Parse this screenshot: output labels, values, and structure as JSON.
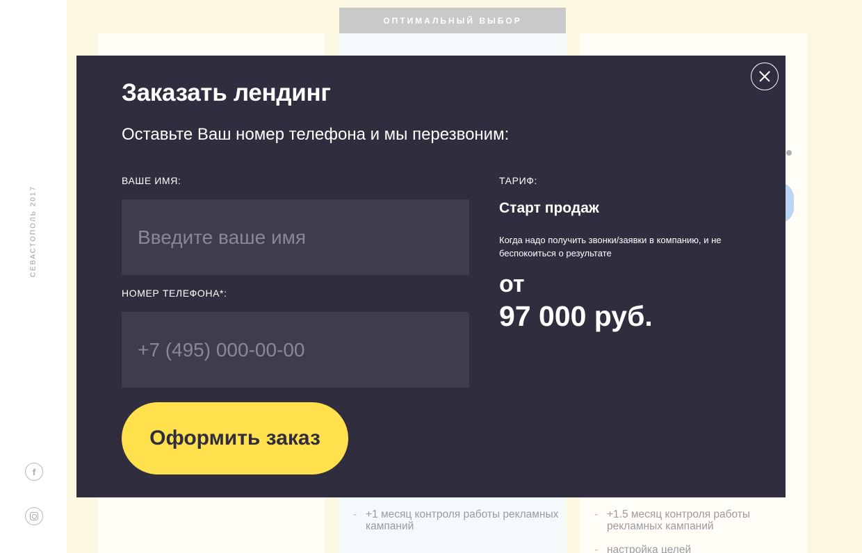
{
  "background": {
    "city_year": "СЕВАСТОПОЛЬ 2017",
    "optimal_badge": "ОПТИМАЛЬНЫЙ ВЫБОР",
    "features": {
      "card2_item": "+1 месяц контроля работы рекламных кампаний",
      "card3_item": "+1.5 месяц контроля работы рекламных кампаний",
      "card3_item2": "настройка целей"
    },
    "social": {
      "facebook_glyph": "f"
    }
  },
  "modal": {
    "title": "Заказать лендинг",
    "subtitle": "Оставьте Ваш номер телефона и мы перезвоним:",
    "name_label": "ВАШЕ ИМЯ:",
    "name_placeholder": "Введите ваше имя",
    "name_value": "",
    "phone_label": "НОМЕР ТЕЛЕФОНА*:",
    "phone_placeholder": "+7 (495) 000-00-00",
    "phone_value": "",
    "submit_label": "Оформить заказ",
    "tariff": {
      "label": "ТАРИФ:",
      "name": "Старт продаж",
      "description": "Когда надо получить звонки/заявки в компанию, и не беспокоиться о результате",
      "price_prefix": "от",
      "price": "97 000 руб."
    }
  },
  "colors": {
    "modal_bg": "#2f2d3e",
    "accent_yellow": "#ffe04d",
    "page_bg": "#fdf8e1",
    "input_bg": "#3e3c4d"
  },
  "icons": [
    "facebook-icon",
    "instagram-icon",
    "close-icon"
  ]
}
